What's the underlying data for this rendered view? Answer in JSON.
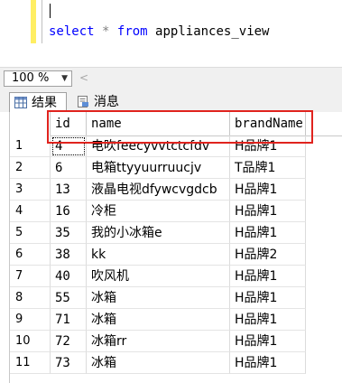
{
  "editor": {
    "sql_keyword_select": "select",
    "sql_star": "*",
    "sql_keyword_from": "from",
    "sql_table": "appliances_view"
  },
  "zoom": {
    "value": "100 %"
  },
  "tabs": [
    {
      "label": "结果",
      "icon": "grid-icon",
      "active": true
    },
    {
      "label": "消息",
      "icon": "message-icon",
      "active": false
    }
  ],
  "grid": {
    "columns": [
      "id",
      "name",
      "brandName"
    ],
    "rows": [
      {
        "num": "1",
        "id": "4",
        "name": "电吹feecyvvtctcfdv",
        "brand": "H品牌1"
      },
      {
        "num": "2",
        "id": "6",
        "name": "电箱ttyyuurruucjv",
        "brand": "T品牌1"
      },
      {
        "num": "3",
        "id": "13",
        "name": "液晶电视dfywcvgdcb",
        "brand": "H品牌1"
      },
      {
        "num": "4",
        "id": "16",
        "name": "冷柜",
        "brand": "H品牌1"
      },
      {
        "num": "5",
        "id": "35",
        "name": "我的小冰箱e",
        "brand": "H品牌1"
      },
      {
        "num": "6",
        "id": "38",
        "name": "kk",
        "brand": "H品牌2"
      },
      {
        "num": "7",
        "id": "40",
        "name": "吹风机",
        "brand": "H品牌1"
      },
      {
        "num": "8",
        "id": "55",
        "name": "冰箱",
        "brand": "H品牌1"
      },
      {
        "num": "9",
        "id": "71",
        "name": "冰箱",
        "brand": "H品牌1"
      },
      {
        "num": "10",
        "id": "72",
        "name": "冰箱rr",
        "brand": "H品牌1"
      },
      {
        "num": "11",
        "id": "73",
        "name": "冰箱",
        "brand": "H品牌1"
      }
    ]
  },
  "colors": {
    "highlight": "#e0231e",
    "keyword": "#0000ff",
    "gutter": "#ffee62"
  }
}
